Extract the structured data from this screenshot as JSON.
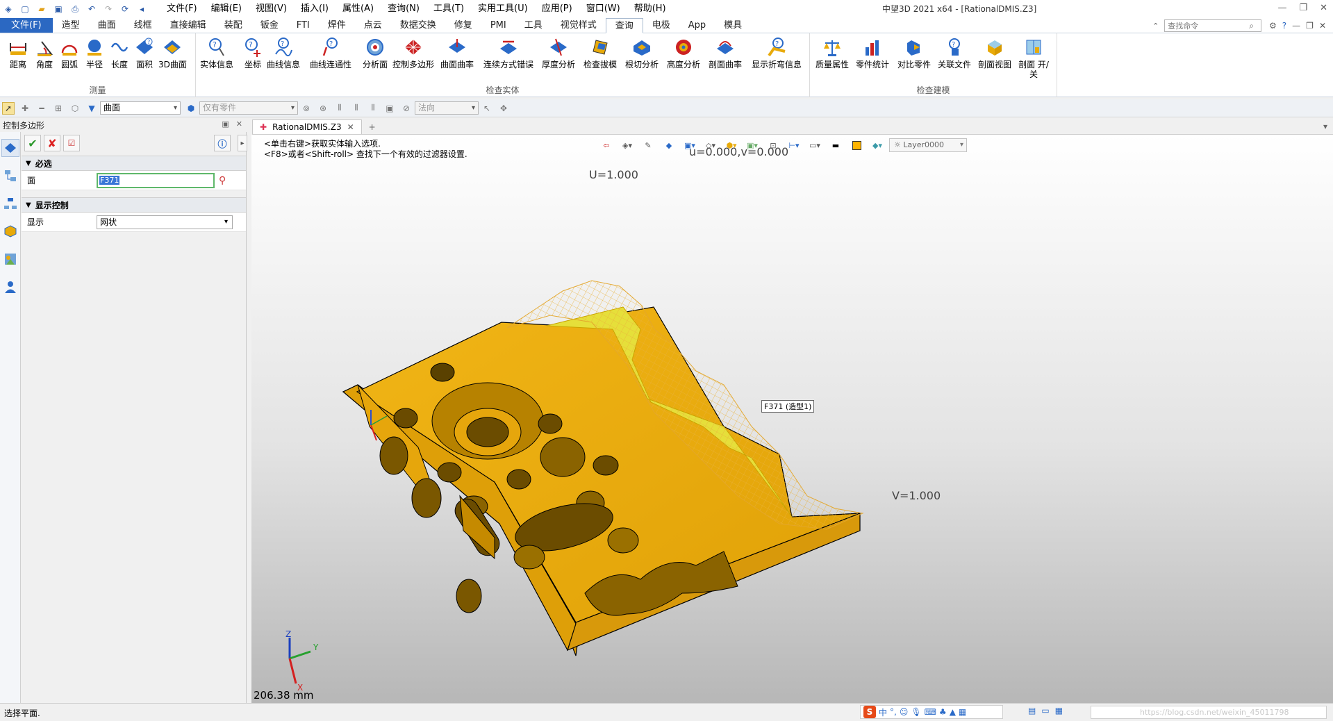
{
  "titlebar": {
    "menus": [
      "文件(F)",
      "编辑(E)",
      "视图(V)",
      "插入(I)",
      "属性(A)",
      "查询(N)",
      "工具(T)",
      "实用工具(U)",
      "应用(P)",
      "窗口(W)",
      "帮助(H)"
    ],
    "title": "中望3D 2021 x64 - [RationalDMIS.Z3]"
  },
  "ribbon_tabs": [
    "文件(F)",
    "造型",
    "曲面",
    "线框",
    "直接编辑",
    "装配",
    "钣金",
    "FTI",
    "焊件",
    "点云",
    "数据交换",
    "修复",
    "PMI",
    "工具",
    "视觉样式",
    "查询",
    "电极",
    "App",
    "模具"
  ],
  "active_tab": "查询",
  "search": {
    "placeholder": "查找命令"
  },
  "ribbon": {
    "groups": [
      {
        "label": "测量",
        "buttons": [
          "距离",
          "角度",
          "圆弧",
          "半径",
          "长度",
          "面积",
          "3D曲面"
        ]
      },
      {
        "label": "检查实体",
        "buttons": [
          "实体信息",
          "坐标",
          "曲线信息",
          "曲线连通性",
          "分析面",
          "控制多边形",
          "曲面曲率",
          "连续方式错误",
          "厚度分析",
          "检查拔模",
          "根切分析",
          "高度分析",
          "剖面曲率",
          "显示折弯信息"
        ]
      },
      {
        "label": "检查建模",
        "buttons": [
          "质量属性",
          "零件统计",
          "对比零件",
          "关联文件",
          "剖面视图",
          "剖面 开/关"
        ]
      }
    ]
  },
  "toolbar2": {
    "filter_value": "曲面",
    "scope_value": "仅有零件",
    "direction_value": "法向"
  },
  "panel": {
    "title": "控制多边形",
    "sections": {
      "required": "必选",
      "display_control": "显示控制"
    },
    "face_label": "面",
    "face_value": "F371",
    "display_label": "显示",
    "display_value": "网状"
  },
  "doc_tab": {
    "label": "RationalDMIS.Z3"
  },
  "viewport": {
    "hint_line1": "<单击右键>获取实体输入选项.",
    "hint_line2": "<F8>或者<Shift-roll> 查找下一个有效的过滤器设置.",
    "layer": "Layer0000",
    "label_uv0": "u=0.000,v=0.000",
    "label_u1": "U=1.000",
    "label_v1": "V=1.000",
    "face_tag": "F371 (造型1)",
    "axis_x": "X",
    "axis_y": "Y",
    "axis_z": "Z",
    "scale": "206.38 mm"
  },
  "status": {
    "message": "选择平面.",
    "ime_logo": "S",
    "ime_lang": "中",
    "ime_punct": "°,",
    "watermark": "https://blog.csdn.net/weixin_45011798"
  },
  "colors": {
    "part": "#e8aa0a",
    "part_edge": "#000000",
    "mesh": "#f2c04a",
    "face_highlight": "#e6df3a",
    "accent": "#2b68c2"
  }
}
